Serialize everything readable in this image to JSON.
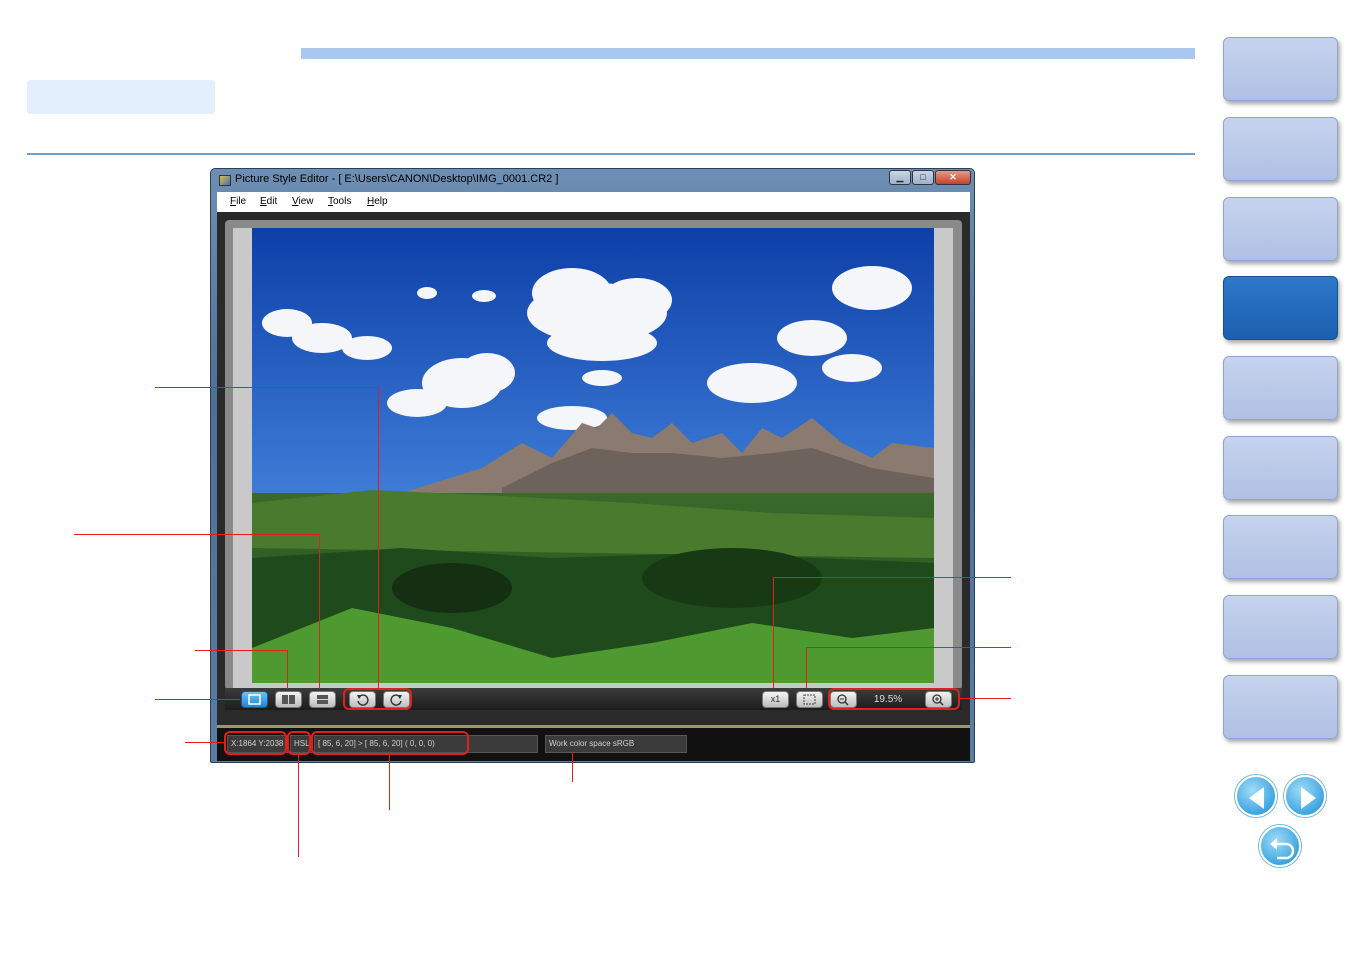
{
  "window": {
    "title": "Picture Style Editor - [ E:\\Users\\CANON\\Desktop\\IMG_0001.CR2 ]",
    "controls": {
      "minimize": "▁",
      "maximize": "□",
      "close": "✕"
    }
  },
  "menu": {
    "items": [
      {
        "mnemonic": "F",
        "rest": "ile"
      },
      {
        "mnemonic": "E",
        "rest": "dit"
      },
      {
        "mnemonic": "V",
        "rest": "iew"
      },
      {
        "mnemonic": "T",
        "rest": "ools"
      },
      {
        "mnemonic": "H",
        "rest": "elp"
      }
    ]
  },
  "toolbar": {
    "zoom_level": "19.5%",
    "icons": [
      "single-view-icon",
      "side-by-side-view-icon",
      "top-bottom-view-icon",
      "rotate-left-icon",
      "rotate-right-icon",
      "actual-size-icon",
      "fit-to-window-icon",
      "zoom-out-icon",
      "zoom-in-icon"
    ],
    "actual_size_label": "x1"
  },
  "status": {
    "coordinates": "X:1864 Y:2038",
    "color_mode": "HSL",
    "values": "[ 85,  6, 20] > [ 85,  6, 20]  (  0,  0,  0)",
    "work_color_space": "Work color space  sRGB"
  },
  "colors": {
    "accent": "#e0201a",
    "nav_active": "#2f78c9",
    "nav_inactive": "#c6d3ee"
  }
}
